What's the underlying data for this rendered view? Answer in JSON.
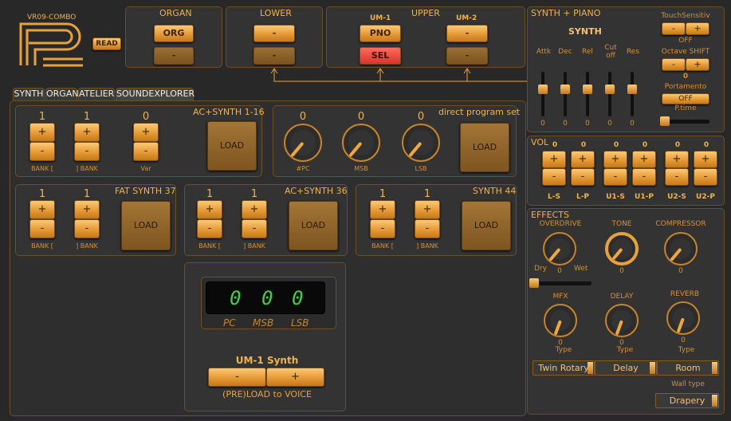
{
  "logo": {
    "title": "VR09-COMBO",
    "read_label": "READ"
  },
  "organ_panel": {
    "title": "ORGAN",
    "org_label": "ORG",
    "lower_label": "-"
  },
  "lower_panel": {
    "title": "LOWER",
    "btn1": "-",
    "btn2": "-"
  },
  "upper_panel": {
    "title": "UPPER",
    "um1_label": "UM-1",
    "um2_label": "UM-2",
    "pno_label": "PNO",
    "sel_label": "SEL",
    "um2_btn1": "-",
    "um2_btn2": "-"
  },
  "tabs": [
    {
      "label": "SYNTH"
    },
    {
      "label": "ORGAN"
    },
    {
      "label": "ATELIER"
    },
    {
      "label": "SOUNDEXPLORER"
    }
  ],
  "synth_piano": {
    "title": "SYNTH + PIANO",
    "synth_label": "SYNTH",
    "touch": {
      "label": "TouchSensitiv",
      "minus": "-",
      "plus": "+",
      "value": "OFF"
    },
    "octave": {
      "label": "Octave SHIFT",
      "minus": "-",
      "plus": "+",
      "value": "0"
    },
    "portamento": {
      "label": "Portamento",
      "button": "OFF",
      "ptime_label": "P.time",
      "ptime_level": 0
    },
    "faders": [
      {
        "label": "Attk",
        "value": "0"
      },
      {
        "label": "Dec",
        "value": "0"
      },
      {
        "label": "Rel",
        "value": "0"
      },
      {
        "label": "Cut off",
        "value": "0"
      },
      {
        "label": "Res",
        "value": "0"
      }
    ]
  },
  "ac_synth_16": {
    "title": "AC+SYNTH 1-16",
    "bank1": "1",
    "bank2": "1",
    "var": "0",
    "plus": "+",
    "minus": "-",
    "bank1_label": "BANK [",
    "bank2_label": "] BANK",
    "var_label": "Var",
    "load": "LOAD"
  },
  "direct_program": {
    "title": "direct program set",
    "pc": "0",
    "msb": "0",
    "lsb": "0",
    "pc_label": "#PC",
    "msb_label": "MSB",
    "lsb_label": "LSB",
    "load": "LOAD"
  },
  "fat_synth": {
    "title": "FAT SYNTH 37",
    "bank1": "1",
    "bank2": "1",
    "bank1_label": "BANK [",
    "bank2_label": "] BANK",
    "load": "LOAD"
  },
  "ac_synth_36": {
    "title": "AC+SYNTH 36",
    "bank1": "1",
    "bank2": "1",
    "bank1_label": "BANK [",
    "bank2_label": "] BANK",
    "load": "LOAD"
  },
  "synth_44": {
    "title": "SYNTH 44",
    "bank1": "1",
    "bank2": "1",
    "bank1_label": "BANK [",
    "bank2_label": "] BANK",
    "load": "LOAD"
  },
  "display": {
    "d1": "0",
    "d2": "0",
    "d3": "0",
    "pc_label": "PC",
    "msb_label": "MSB",
    "lsb_label": "LSB",
    "title": "UM-1 Synth",
    "minus": "-",
    "plus": "+",
    "footer": "(PRE)LOAD to VOICE"
  },
  "vol": {
    "title": "VOL",
    "channels": [
      {
        "label": "L-S",
        "value": "0"
      },
      {
        "label": "L-P",
        "value": "0"
      },
      {
        "label": "U1-S",
        "value": "0"
      },
      {
        "label": "U1-P",
        "value": "0"
      },
      {
        "label": "U2-S",
        "value": "0"
      },
      {
        "label": "U2-P",
        "value": "0"
      }
    ]
  },
  "effects": {
    "title": "EFFECTS",
    "overdrive": {
      "label": "OVERDRIVE",
      "value": "0",
      "dry": "Dry",
      "wet": "Wet",
      "slider_level": 0
    },
    "tone": {
      "label": "TONE",
      "value": "0"
    },
    "compressor": {
      "label": "COMPRESSOR",
      "value": "0"
    },
    "mfx": {
      "label": "MFX",
      "value": "0",
      "type_label": "Type",
      "type_value": "Twin Rotary"
    },
    "delay": {
      "label": "DELAY",
      "value": "0",
      "type_label": "Type",
      "type_value": "Delay"
    },
    "reverb": {
      "label": "REVERB",
      "value": "0",
      "type_label": "Type",
      "type_value": "Room"
    },
    "wall_label": "Wall type",
    "wall_value": "Drapery"
  },
  "colors": {
    "accent": "#e8a23a",
    "background": "#282828",
    "panel": "#333333",
    "red_button": "#d8342a",
    "led": "#3fd23f"
  }
}
